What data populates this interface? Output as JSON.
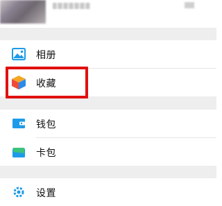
{
  "menu": {
    "items": [
      {
        "label": "相册",
        "icon": "photo-icon"
      },
      {
        "label": "收藏",
        "icon": "favorites-cube-icon"
      },
      {
        "label": "钱包",
        "icon": "wallet-icon"
      },
      {
        "label": "卡包",
        "icon": "card-pack-icon"
      },
      {
        "label": "设置",
        "icon": "gear-icon"
      }
    ]
  },
  "colors": {
    "accent_blue": "#1e9be8",
    "highlight_red": "#e01010",
    "cube_orange": "#f5a623",
    "cube_red": "#f04b3a",
    "cube_blue": "#2a8bea",
    "card_green": "#3bc47a"
  },
  "annotation": {
    "highlighted_item": "收藏"
  }
}
